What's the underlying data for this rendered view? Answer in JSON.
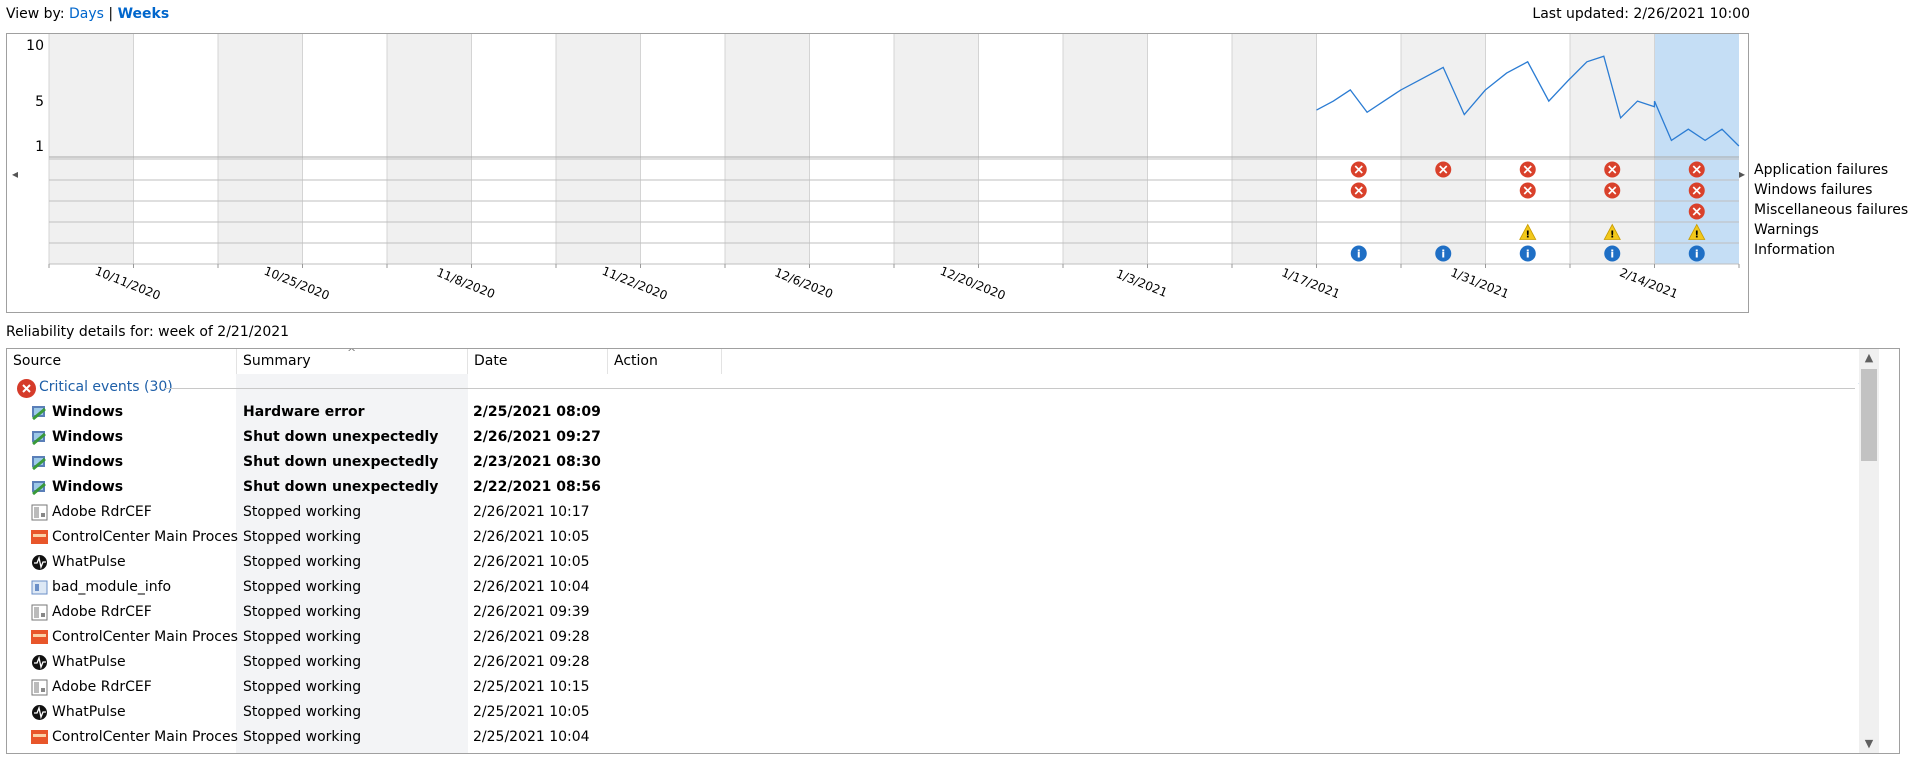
{
  "header": {
    "view_by_label": "View by:",
    "view_days": "Days",
    "view_separator": "|",
    "view_weeks": "Weeks",
    "last_updated": "Last updated: 2/26/2021 10:00"
  },
  "chart": {
    "y_ticks": [
      "10",
      "5",
      "1"
    ],
    "x_labels": [
      "10/11/2020",
      "10/25/2020",
      "11/8/2020",
      "11/22/2020",
      "12/6/2020",
      "12/20/2020",
      "1/3/2021",
      "1/17/2021",
      "1/31/2021",
      "2/14/2021"
    ],
    "row_labels": [
      "Application failures",
      "Windows failures",
      "Miscellaneous failures",
      "Warnings",
      "Information"
    ],
    "nav_left": "◂",
    "nav_right": "▸",
    "column_count": 20,
    "selected_column": 19,
    "events": {
      "application_failures": [
        15,
        16,
        17,
        18,
        19
      ],
      "windows_failures": [
        15,
        17,
        18,
        19
      ],
      "miscellaneous_failures": [
        19
      ],
      "warnings": [
        17,
        18,
        19
      ],
      "information": [
        15,
        16,
        17,
        18,
        19
      ]
    },
    "stability_index": [
      {
        "week": 15,
        "points": [
          4.2,
          5.0,
          6.0,
          4.0,
          5.0,
          6.0
        ]
      },
      {
        "week": 16,
        "points": [
          6.0,
          7.0,
          8.0,
          3.8,
          6.0
        ]
      },
      {
        "week": 17,
        "points": [
          6.0,
          7.5,
          8.5,
          5.0,
          7.0
        ]
      },
      {
        "week": 18,
        "points": [
          7.0,
          8.5,
          9.0,
          3.5,
          5.0,
          4.5
        ]
      },
      {
        "week": 19,
        "points": [
          5.0,
          1.5,
          2.5,
          1.5,
          2.5,
          1.0
        ]
      }
    ],
    "accent_color": "#2b7cd3",
    "selected_fill": "#c5def5",
    "alt_fill": "#f0f0f0"
  },
  "details": {
    "title": "Reliability details for: week of 2/21/2021",
    "columns": [
      "Source",
      "Summary",
      "Date",
      "Action"
    ],
    "sort_indicator": "^",
    "group_label": "Critical events (30)",
    "collapse_glyph": "^",
    "rows": [
      {
        "source": "Windows",
        "summary": "Hardware error",
        "date": "2/25/2021 08:09",
        "bold": true,
        "icon": "windows-icon"
      },
      {
        "source": "Windows",
        "summary": "Shut down unexpectedly",
        "date": "2/26/2021 09:27",
        "bold": true,
        "icon": "windows-icon"
      },
      {
        "source": "Windows",
        "summary": "Shut down unexpectedly",
        "date": "2/23/2021 08:30",
        "bold": true,
        "icon": "windows-icon"
      },
      {
        "source": "Windows",
        "summary": "Shut down unexpectedly",
        "date": "2/22/2021 08:56",
        "bold": true,
        "icon": "windows-icon"
      },
      {
        "source": "Adobe RdrCEF",
        "summary": "Stopped working",
        "date": "2/26/2021 10:17",
        "bold": false,
        "icon": "application-icon"
      },
      {
        "source": "ControlCenter Main Process",
        "summary": "Stopped working",
        "date": "2/26/2021 10:05",
        "bold": false,
        "icon": "controlcenter-icon"
      },
      {
        "source": "WhatPulse",
        "summary": "Stopped working",
        "date": "2/26/2021 10:05",
        "bold": false,
        "icon": "whatpulse-icon"
      },
      {
        "source": "bad_module_info",
        "summary": "Stopped working",
        "date": "2/26/2021 10:04",
        "bold": false,
        "icon": "module-icon"
      },
      {
        "source": "Adobe RdrCEF",
        "summary": "Stopped working",
        "date": "2/26/2021 09:39",
        "bold": false,
        "icon": "application-icon"
      },
      {
        "source": "ControlCenter Main Process",
        "summary": "Stopped working",
        "date": "2/26/2021 09:28",
        "bold": false,
        "icon": "controlcenter-icon"
      },
      {
        "source": "WhatPulse",
        "summary": "Stopped working",
        "date": "2/26/2021 09:28",
        "bold": false,
        "icon": "whatpulse-icon"
      },
      {
        "source": "Adobe RdrCEF",
        "summary": "Stopped working",
        "date": "2/25/2021 10:15",
        "bold": false,
        "icon": "application-icon"
      },
      {
        "source": "WhatPulse",
        "summary": "Stopped working",
        "date": "2/25/2021 10:05",
        "bold": false,
        "icon": "whatpulse-icon"
      },
      {
        "source": "ControlCenter Main Process",
        "summary": "Stopped working",
        "date": "2/25/2021 10:04",
        "bold": false,
        "icon": "controlcenter-icon"
      }
    ],
    "scroll_up": "▲",
    "scroll_down": "▼"
  }
}
